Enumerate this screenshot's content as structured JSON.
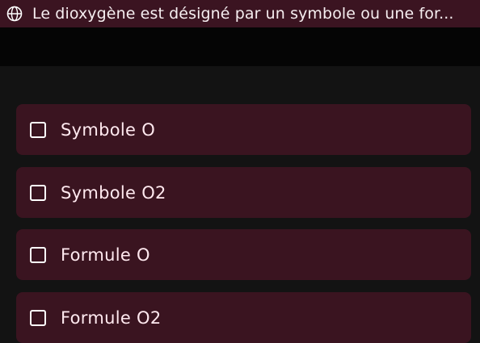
{
  "question": {
    "icon": "globe-icon",
    "text": "Le dioxygène est désigné par un symbole ou une for..."
  },
  "options": [
    {
      "label": "Symbole O",
      "checked": false
    },
    {
      "label": "Symbole O2",
      "checked": false
    },
    {
      "label": "Formule O",
      "checked": false
    },
    {
      "label": "Formule O2",
      "checked": false
    }
  ],
  "colors": {
    "topbar": "#3b1421",
    "option_bg": "#3a1420",
    "page_bg": "#131313",
    "text": "#ffe9ef"
  }
}
